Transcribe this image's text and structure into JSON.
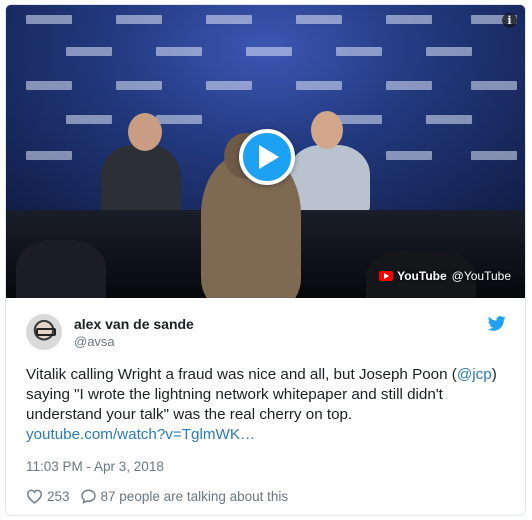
{
  "media": {
    "source_name": "YouTube",
    "source_handle": "@YouTube",
    "info_glyph": "i"
  },
  "author": {
    "name": "alex van de sande",
    "handle": "@avsa"
  },
  "tweet": {
    "text_part1": "Vitalik calling Wright a fraud was nice and all, but Joseph Poon (",
    "mention": "@jcp",
    "text_part2": ") saying \"I wrote the lightning network whitepaper and still didn't understand your talk\" was the real cherry on top.",
    "link": "youtube.com/watch?v=TglmWK…"
  },
  "timestamp": "11:03 PM - Apr 3, 2018",
  "stats": {
    "likes": "253",
    "conversation": "87 people are talking about this"
  },
  "icons": [
    "play-icon",
    "info-icon",
    "youtube-icon",
    "twitter-bird-icon",
    "heart-icon",
    "comment-icon"
  ],
  "colors": {
    "accent": "#1da1f2",
    "link": "#2b7bb9",
    "muted": "#697882",
    "youtube_red": "#ff0000"
  }
}
